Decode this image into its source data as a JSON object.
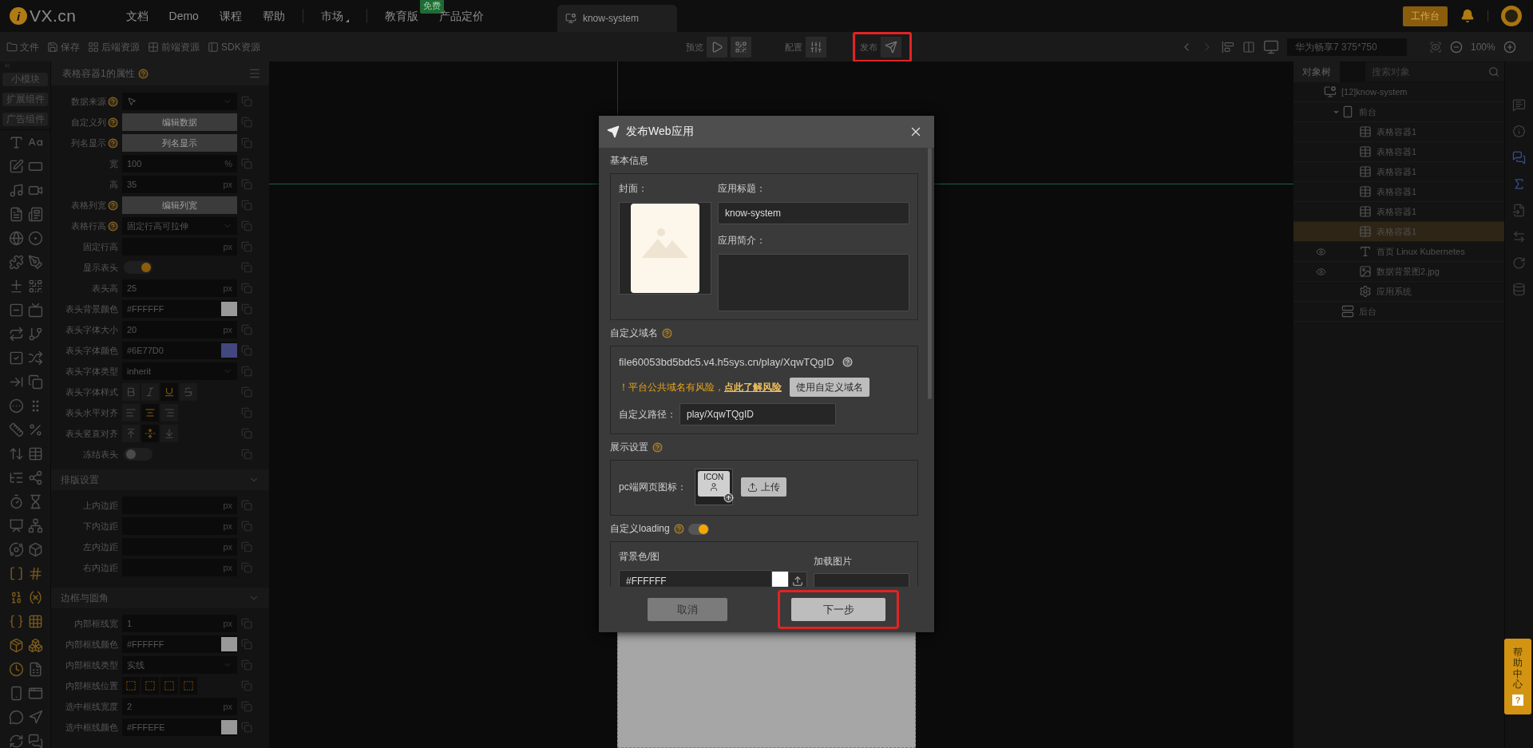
{
  "topbar": {
    "logo": {
      "mark": "i",
      "text": "VX.cn"
    },
    "nav_groups": [
      [
        {
          "label": "文档"
        },
        {
          "label": "Demo"
        },
        {
          "label": "课程"
        },
        {
          "label": "帮助"
        }
      ],
      [
        {
          "label": "市场",
          "dropdown": true
        }
      ],
      [
        {
          "label": "教育版",
          "badge": "免费"
        },
        {
          "label": "产品定价"
        }
      ]
    ],
    "tabs": [
      {
        "label": "know-system",
        "selected": true
      }
    ],
    "workbench_button": "工作台"
  },
  "toolbar": {
    "file_actions": [
      "文件",
      "保存",
      "后端资源",
      "前端资源",
      "SDK资源"
    ],
    "center_groups": [
      {
        "label": "预览",
        "highlighted": false
      },
      {
        "label": "配置",
        "highlighted": false
      },
      {
        "label": "发布",
        "highlighted": true
      }
    ],
    "device": "华为畅享7 375*750",
    "zoom": "100%"
  },
  "component_tabs": [
    "小模块",
    "扩展组件",
    "广告组件"
  ],
  "properties": {
    "title": "表格容器1的属性",
    "rows": [
      {
        "kind": "picker",
        "label": "数据来源",
        "help": true
      },
      {
        "kind": "button",
        "label": "自定义列",
        "help": true,
        "value": "编辑数据"
      },
      {
        "kind": "button",
        "label": "列名显示",
        "help": true,
        "value": "列名显示"
      },
      {
        "kind": "input",
        "label": "宽",
        "value": "100",
        "unit": "%"
      },
      {
        "kind": "input",
        "label": "高",
        "value": "35",
        "unit": "px"
      },
      {
        "kind": "button",
        "label": "表格列宽",
        "help": true,
        "value": "编辑列宽"
      },
      {
        "kind": "select",
        "label": "表格行高",
        "help": true,
        "value": "固定行高可拉伸"
      },
      {
        "kind": "input",
        "label": "固定行高",
        "unit": "px"
      },
      {
        "kind": "toggle",
        "label": "显示表头",
        "on": true
      },
      {
        "kind": "input",
        "label": "表头高",
        "value": "25",
        "unit": "px"
      },
      {
        "kind": "color",
        "label": "表头背景颜色",
        "value": "#FFFFFF"
      },
      {
        "kind": "input",
        "label": "表头字体大小",
        "value": "20",
        "unit": "px"
      },
      {
        "kind": "color",
        "label": "表头字体颜色",
        "value": "#6E77D0"
      },
      {
        "kind": "select",
        "label": "表头字体类型",
        "value": "inherit"
      },
      {
        "kind": "font-style",
        "label": "表头字体样式",
        "options": [
          {
            "selected": false
          },
          {
            "selected": false
          },
          {
            "selected": true
          },
          {
            "selected": false
          }
        ]
      },
      {
        "kind": "h-align",
        "label": "表头水平对齐",
        "options": [
          {
            "selected": false
          },
          {
            "selected": true
          },
          {
            "selected": false
          }
        ]
      },
      {
        "kind": "v-align",
        "label": "表头竖直对齐",
        "options": [
          {
            "selected": false
          },
          {
            "selected": true
          },
          {
            "selected": false
          }
        ]
      },
      {
        "kind": "toggle",
        "label": "冻结表头",
        "on": false
      }
    ],
    "sections": [
      {
        "title": "排版设置",
        "expanded": true,
        "rows": [
          {
            "kind": "input",
            "label": "上内边距",
            "unit": "px"
          },
          {
            "kind": "input",
            "label": "下内边距",
            "unit": "px"
          },
          {
            "kind": "input",
            "label": "左内边距",
            "unit": "px"
          },
          {
            "kind": "input",
            "label": "右内边距",
            "unit": "px"
          }
        ]
      },
      {
        "title": "边框与圆角",
        "expanded": true,
        "rows": [
          {
            "kind": "input",
            "label": "内部框线宽",
            "value": "1",
            "unit": "px"
          },
          {
            "kind": "color",
            "label": "内部框线颜色",
            "value": "#FFFFFF"
          },
          {
            "kind": "select",
            "label": "内部框线类型",
            "value": "实线"
          },
          {
            "kind": "border-position",
            "label": "内部框线位置",
            "options": [
              {
                "selected": true
              },
              {
                "selected": true
              },
              {
                "selected": true
              },
              {
                "selected": true
              }
            ]
          },
          {
            "kind": "input",
            "label": "选中框线宽度",
            "value": "2",
            "unit": "px"
          },
          {
            "kind": "color",
            "label": "选中框线颜色",
            "value": "#FFFEFE"
          }
        ]
      }
    ]
  },
  "object_tree": {
    "tab": "对象树",
    "search_placeholder": "搜索对象",
    "nodes": [
      {
        "kind": "app",
        "label": "[12]know-system",
        "selected": false,
        "eye": false,
        "children": [
          {
            "kind": "device",
            "label": "前台",
            "selected": false,
            "eye": false,
            "expanded": true,
            "children": [
              {
                "kind": "table",
                "label": "表格容器1",
                "selected": false,
                "eye": false
              },
              {
                "kind": "table",
                "label": "表格容器1",
                "selected": false,
                "eye": false
              },
              {
                "kind": "table",
                "label": "表格容器1",
                "selected": false,
                "eye": false
              },
              {
                "kind": "table",
                "label": "表格容器1",
                "selected": false,
                "eye": false
              },
              {
                "kind": "table",
                "label": "表格容器1",
                "selected": false,
                "eye": false
              },
              {
                "kind": "table",
                "label": "表格容器1",
                "selected": true,
                "eye": false
              },
              {
                "kind": "text",
                "label": "首页 Linux Kubernetes",
                "selected": false,
                "eye": true
              },
              {
                "kind": "image",
                "label": "数据背景图2.jpg",
                "selected": false,
                "eye": true
              },
              {
                "kind": "settings",
                "label": "应用系统",
                "selected": false,
                "eye": false
              }
            ]
          },
          {
            "kind": "server",
            "label": "后台",
            "selected": false,
            "eye": false
          }
        ]
      }
    ]
  },
  "dialog": {
    "title": "发布Web应用",
    "basic": {
      "heading": "基本信息",
      "cover_label": "封面：",
      "title_label": "应用标题：",
      "title_value": "know-system",
      "intro_label": "应用简介："
    },
    "domain": {
      "heading": "自定义域名",
      "url": "file60053bd5bdc5.v4.h5sys.cn/play/XqwTQgID",
      "warning": "！平台公共域名有风险，",
      "warning_link": "点此了解风险",
      "custom_button": "使用自定义域名",
      "path_label": "自定义路径：",
      "path_value": "play/XqwTQgID"
    },
    "display": {
      "heading": "展示设置",
      "icon_label": "pc端网页图标：",
      "icon_placeholder": "ICON",
      "upload_button": "上传"
    },
    "loading": {
      "heading": "自定义loading",
      "on": true,
      "bg_label": "背景色/图",
      "bg_value": "#FFFFFF",
      "image_label": "加载图片"
    },
    "cancel_button": {
      "label": "取消",
      "highlighted": false
    },
    "next_button": {
      "label": "下一步",
      "highlighted": true
    }
  },
  "help_button": {
    "label": "帮助中心",
    "mark": "?"
  }
}
